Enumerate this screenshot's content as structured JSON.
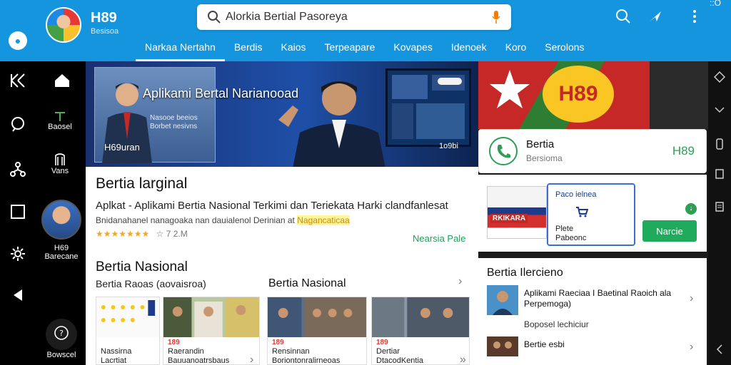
{
  "header": {
    "brand_name": "H89",
    "brand_sub": "Besisoa",
    "search_placeholder": "Alorkia Bertial Pasoreya",
    "icons": [
      "search-icon",
      "share-icon",
      "more-vertical-icon"
    ],
    "top_right_text": "::O"
  },
  "nav": {
    "items": [
      "Narkaa Nertahn",
      "Berdis",
      "Kaios",
      "Terpeapare",
      "Kovapes",
      "Idenoek",
      "Koro",
      "Serolons"
    ],
    "active_index": 0
  },
  "rail": {
    "items": [
      {
        "icon": "brand-k-icon",
        "label": ""
      },
      {
        "icon": "home-icon",
        "label": ""
      },
      {
        "icon": "trend-icon",
        "label": "Baosel"
      },
      {
        "icon": "chat-icon",
        "label": ""
      },
      {
        "icon": "book-icon",
        "label": "Vans"
      },
      {
        "icon": "network-icon",
        "label": ""
      },
      {
        "icon": "square-icon",
        "label": ""
      },
      {
        "icon": "gear-icon",
        "label": ""
      },
      {
        "icon": "back-icon",
        "label": ""
      },
      {
        "icon": "help-icon",
        "label": "Bowscel"
      }
    ],
    "profile": {
      "name": "H69",
      "sub": "Barecane"
    }
  },
  "hero": {
    "title": "Aplikami Bertal Narianooad",
    "caption": "Nasooe beeios Borbet nesivns",
    "name": "H69uran",
    "tag": "1o9bi"
  },
  "flag_badge": "H89",
  "main": {
    "title": "Bertia larginal",
    "description": "Aplkat - Aplikami Bertia Nasional Terkimi dan Teriekata Harki clandfanlesat",
    "sub_text": "Bnidanahanel nanagoaka nan dauialenol Derinian at",
    "sub_highlight": "Nagancaticaa",
    "stars": "★★★★★★★",
    "rating_text": "☆ 7 2.M",
    "link": "Nearsia Pale",
    "section_title": "Bertia Nasional",
    "section_sub_left": "Bertia Raoas (aovaisroa)",
    "section_sub_right": "Bertia Nasional",
    "tiles": [
      {
        "tag": "",
        "label": "Nassirna\nLacrtiat"
      },
      {
        "tag": "189",
        "label": "Raerandin\nBauuanoatrsbaus"
      },
      {
        "tag": "189",
        "label": "Rensinnan\nBoriontonralirneoas"
      },
      {
        "tag": "189",
        "label": "Dertiar\nDtacodKentia"
      }
    ]
  },
  "app_card": {
    "name": "Bertia",
    "sub": "Bersioma",
    "code": "H89"
  },
  "promo": {
    "image_label": "RKIKARA",
    "box_title": "Paco ielnea",
    "box_text": "Plete\nPabeonc",
    "button_label": "Narcie"
  },
  "news": {
    "title": "Bertia Ilercieno",
    "items": [
      {
        "text": "Aplikami Raeciaa I Baetinal Raoich ala Perpemoga)",
        "meta": "Boposel lechiciur"
      },
      {
        "text": "Bertie esbi",
        "meta": ""
      }
    ]
  }
}
